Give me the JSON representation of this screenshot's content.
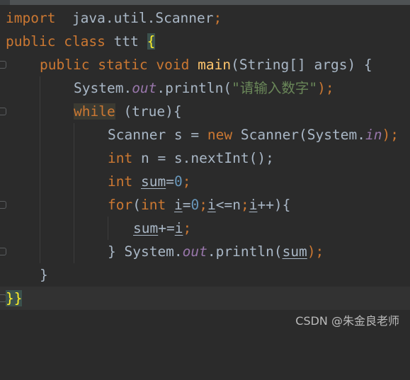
{
  "editor": {
    "lines": [
      {
        "import_kw": "import",
        "import_path": "java.util.Scanner",
        "semicolon": ";"
      },
      {
        "kw1": "public",
        "kw2": "class",
        "name": "ttt",
        "brace": "{"
      },
      {
        "kw1": "public",
        "kw2": "static",
        "kw3": "void",
        "method": "main",
        "params": "(String[] args) {"
      },
      {
        "prefix": "System.",
        "field": "out",
        "call": ".println(",
        "string": "\"请输入数字\"",
        "end": ");"
      },
      {
        "kw": "while",
        "rest": " (true){"
      },
      {
        "text1": "Scanner s = ",
        "kw": "new",
        "text2": " Scanner(System.",
        "field": "in",
        "end": ");"
      },
      {
        "kw": "int",
        "text": " n = s.nextInt();"
      },
      {
        "kw": "int",
        "var": "sum",
        "eq": "=",
        "num": "0",
        "end": ";"
      },
      {
        "kw": "for",
        "open": "(",
        "kw2": "int",
        "var1": "i",
        "eq": "=",
        "num": "0",
        "semi1": ";",
        "var2": "i",
        "cmp": "<=n",
        "semi2": ";",
        "var3": "i",
        "inc": "++){"
      },
      {
        "var1": "sum",
        "op": "+=",
        "var2": "i",
        "end": ";"
      },
      {
        "brace": "} ",
        "prefix": "System.",
        "field": "out",
        "call": ".println(",
        "var": "sum",
        "end": ");"
      },
      {
        "brace": "}"
      },
      {
        "brace": "}}"
      }
    ]
  },
  "watermark": "CSDN @朱金良老师",
  "colors": {
    "background": "#2b2b2b",
    "keyword": "#cc7832",
    "method": "#ffc66d",
    "number": "#6897bb",
    "string": "#6a8759",
    "field": "#9876aa",
    "text": "#a9b7c6"
  }
}
